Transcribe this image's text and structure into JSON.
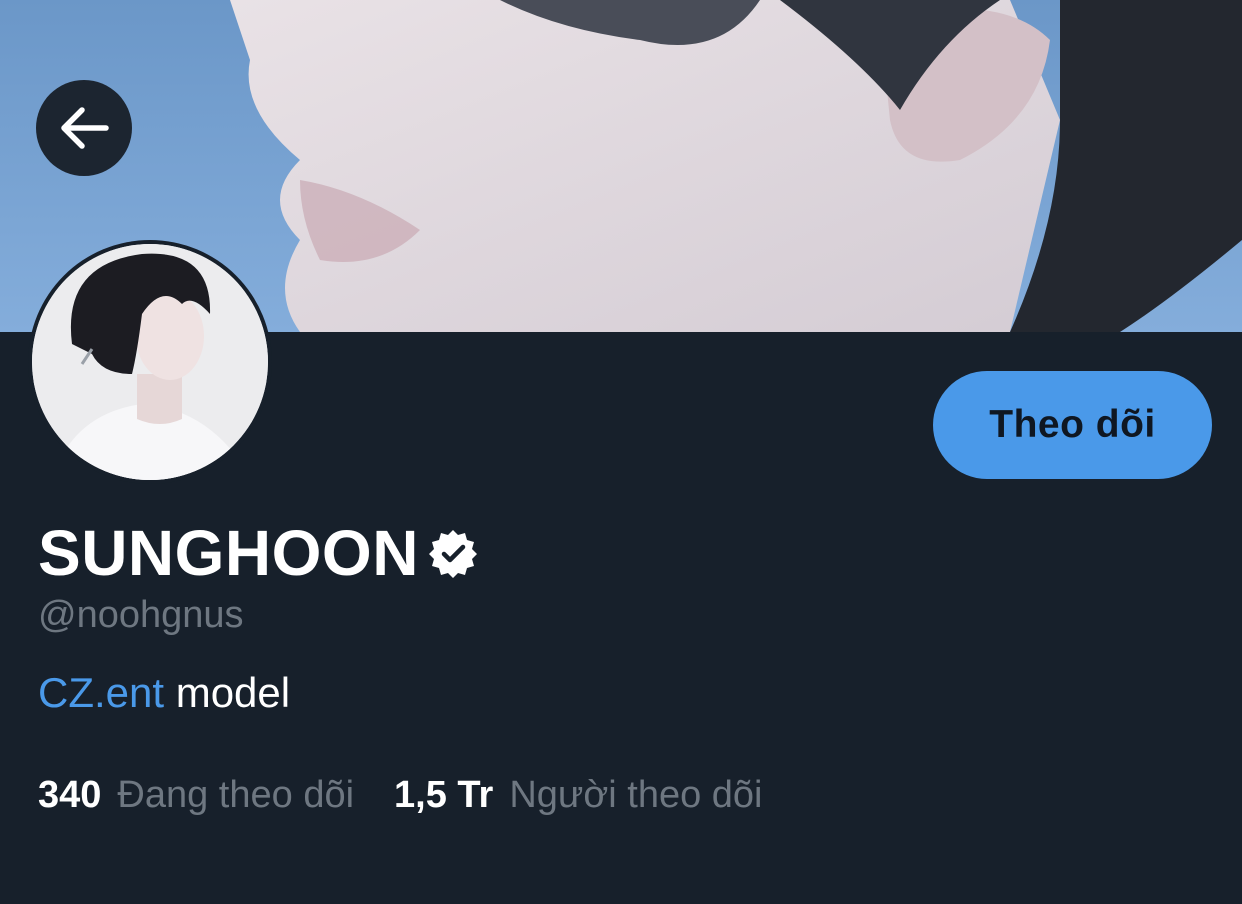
{
  "profile": {
    "display_name": "SUNGHOON",
    "handle": "@noohgnus",
    "bio_link": "CZ.ent",
    "bio_text": " model",
    "verified": true
  },
  "actions": {
    "follow_label": "Theo dõi",
    "back_icon": "arrow-left-icon"
  },
  "stats": {
    "following_count": "340",
    "following_label": "Đang theo dõi",
    "followers_count": "1,5 Tr",
    "followers_label": "Người theo dõi"
  },
  "colors": {
    "background": "#17202b",
    "accent": "#4a99e9",
    "muted": "#6e7781"
  }
}
